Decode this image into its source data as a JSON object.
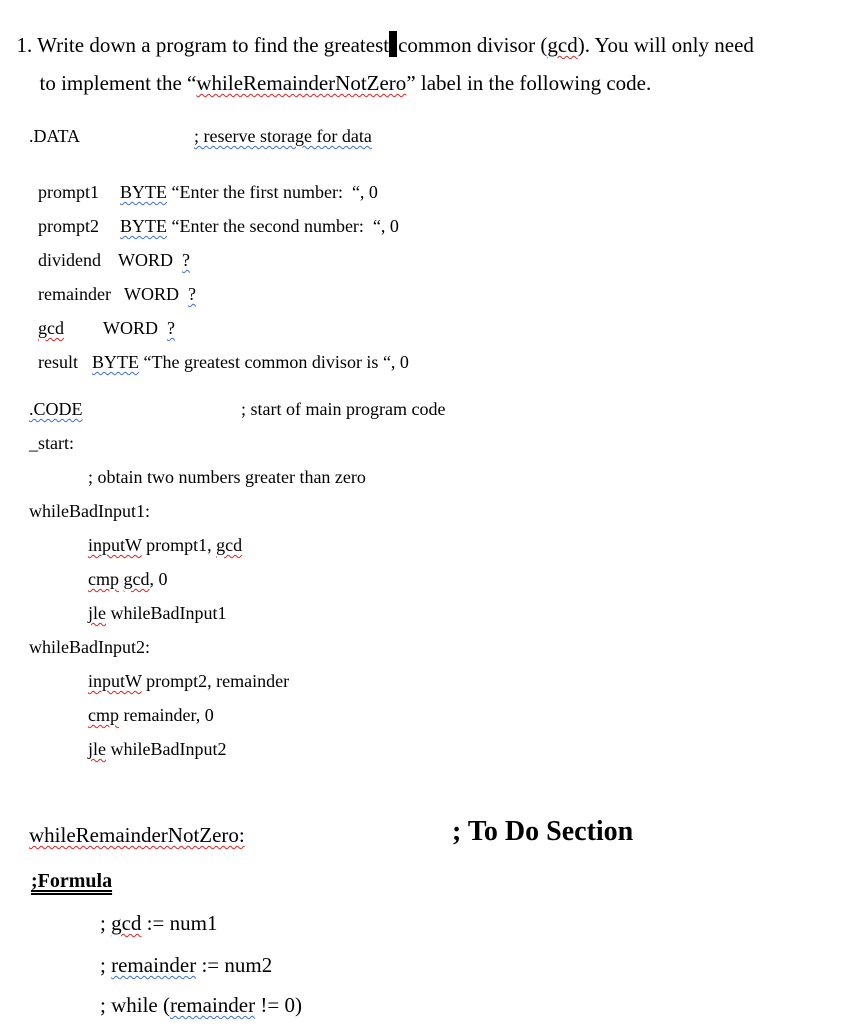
{
  "question": {
    "line1_before_cursor": "1. Write down a program to find the greatest",
    "line1_after_cursor": "common divisor (",
    "line1_gcd": "gcd",
    "line1_end": "). You will only need",
    "line2_start": "to implement the “",
    "line2_label": "whileRemainderNotZero",
    "line2_end": "” label in the following code."
  },
  "data_section": {
    "directive": ".DATA",
    "directive_comment": "; reserve storage for data",
    "rows": [
      {
        "name": "prompt1",
        "type": "BYTE",
        "value": "“Enter the first number:  “, 0"
      },
      {
        "name": "prompt2",
        "type": "BYTE",
        "value": "“Enter the second number:  “, 0"
      },
      {
        "name": "dividend",
        "type": "WORD",
        "value": "?"
      },
      {
        "name": "remainder",
        "type": "WORD",
        "value": "?"
      },
      {
        "name": "gcd",
        "type": "WORD",
        "value": "?"
      },
      {
        "name": "result",
        "type": "BYTE",
        "value": "“The greatest common divisor is “, 0"
      }
    ]
  },
  "code_section": {
    "directive": ".CODE",
    "directive_comment": "; start of main program code",
    "start_label": "_start:",
    "comment_obtain": "; obtain two numbers greater than zero",
    "loop1_label": "whileBadInput1:",
    "loop1": [
      {
        "op": "inputW",
        "args": "prompt1, ",
        "arg2": "gcd"
      },
      {
        "op": "cmp",
        "args": "gcd",
        "arg2": ", 0"
      },
      {
        "op": "jle",
        "args": "whileBadInput1"
      }
    ],
    "loop2_label": "whileBadInput2:",
    "loop2": [
      {
        "op": "inputW",
        "args": "prompt2, remainder"
      },
      {
        "op": "cmp",
        "args": "remainder, 0"
      },
      {
        "op": "jle",
        "args": "whileBadInput2"
      }
    ]
  },
  "todo_section": {
    "label": "whileRemainderNotZero:",
    "todo_comment": "; To Do Section",
    "formula_heading": ";Formula",
    "formula_lines": [
      {
        "prefix": "; ",
        "var": "gcd",
        "op": " := ",
        "rest": "num1"
      },
      {
        "prefix": "; ",
        "var": "remainder",
        "op": " := ",
        "rest": "num2"
      },
      {
        "prefix": "; while (",
        "var": "remainder",
        "op": " != ",
        "rest": "0)"
      }
    ]
  }
}
